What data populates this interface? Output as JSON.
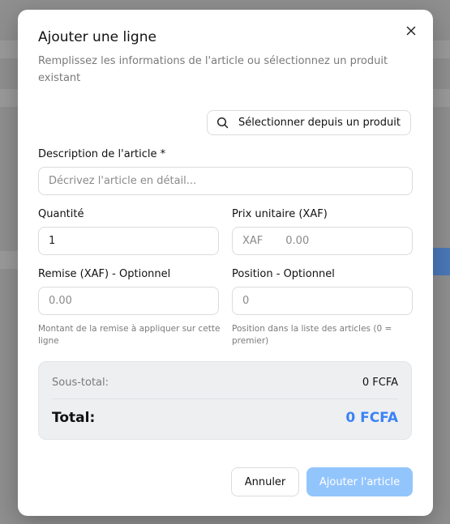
{
  "dialog": {
    "title": "Ajouter une ligne",
    "subtitle": "Remplissez les informations de l'article ou sélectionnez un produit existant",
    "select_product_label": "Sélectionner depuis un produit"
  },
  "form": {
    "description": {
      "label": "Description de l'article *",
      "placeholder": "Décrivez l'article en détail...",
      "value": ""
    },
    "quantity": {
      "label": "Quantité",
      "value": "1"
    },
    "unit_price": {
      "label": "Prix unitaire (XAF)",
      "currency": "XAF",
      "placeholder": "0.00",
      "value": ""
    },
    "discount": {
      "label": "Remise (XAF) - Optionnel",
      "placeholder": "0.00",
      "value": "",
      "help": "Montant de la remise à appliquer sur cette ligne"
    },
    "position": {
      "label": "Position - Optionnel",
      "placeholder": "0",
      "value": "",
      "help": "Position dans la liste des articles (0 = premier)"
    }
  },
  "summary": {
    "subtotal_label": "Sous-total:",
    "subtotal_value": "0 FCFA",
    "total_label": "Total:",
    "total_value": "0 FCFA"
  },
  "actions": {
    "cancel_label": "Annuler",
    "submit_label": "Ajouter l'article"
  },
  "icons": {
    "close": "close-icon",
    "search": "search-icon"
  },
  "colors": {
    "accent": "#3b82f6",
    "submit_disabled": "#93c5fd"
  }
}
